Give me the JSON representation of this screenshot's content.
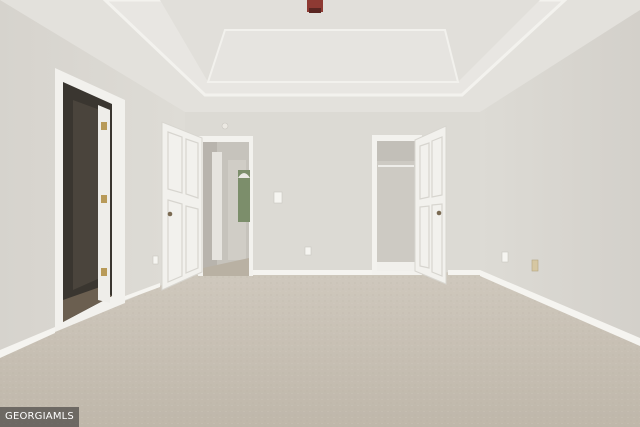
{
  "photo": {
    "subject": "empty-bedroom-interior",
    "watermark_text": "GEORGIAMLS",
    "colors": {
      "wall": "#dcdad4",
      "ceiling": "#e4e2de",
      "carpet": "#c8c0b4",
      "trim": "#f5f4f0",
      "door": "#f2f1ed"
    }
  }
}
